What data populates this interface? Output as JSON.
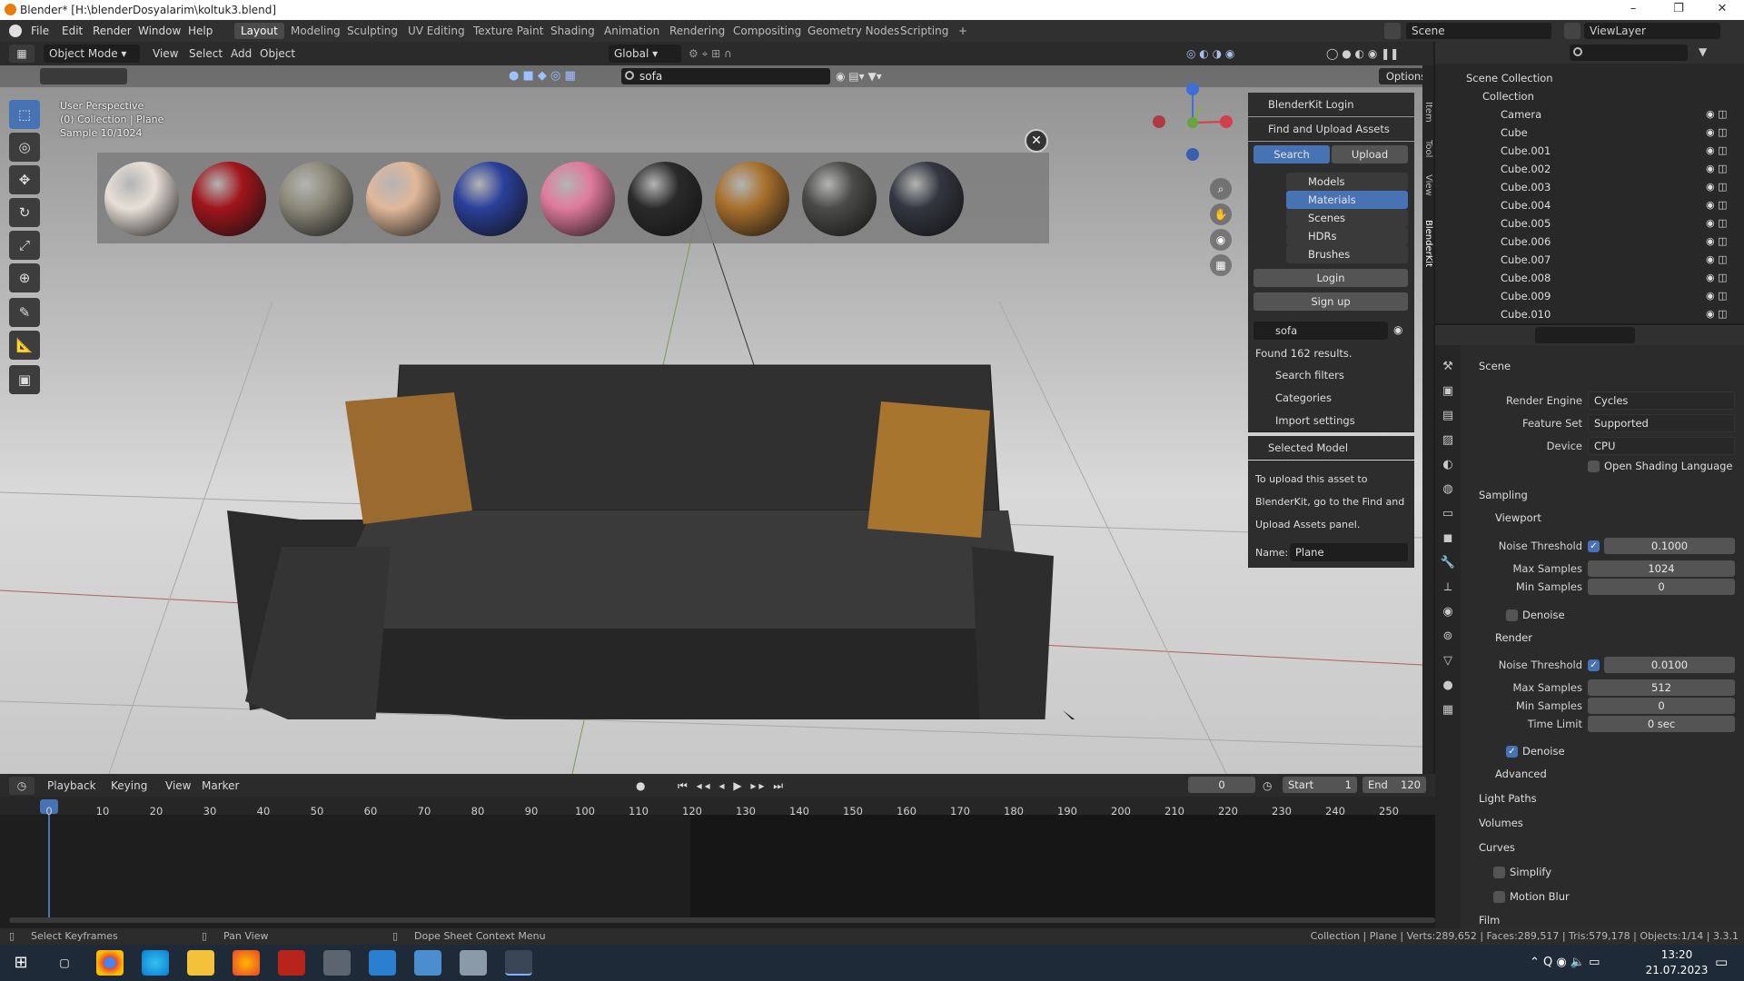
{
  "window": {
    "title": "Blender* [H:\\blenderDosyalarim\\koltuk3.blend]",
    "min": "–",
    "max": "❐",
    "close": "✕"
  },
  "menu": [
    "File",
    "Edit",
    "Render",
    "Window",
    "Help"
  ],
  "workspaces": [
    "Layout",
    "Modeling",
    "Sculpting",
    "UV Editing",
    "Texture Paint",
    "Shading",
    "Animation",
    "Rendering",
    "Compositing",
    "Geometry Nodes",
    "Scripting",
    "+"
  ],
  "scene": {
    "scene_name": "Scene",
    "view_layer": "ViewLayer"
  },
  "header": {
    "mode": "Object Mode",
    "view": "View",
    "select": "Select",
    "add": "Add",
    "object": "Object",
    "orientation": "Global",
    "search": "sofa",
    "options": "Options"
  },
  "overlay": {
    "perspective": "User Perspective",
    "collection": "(0) Collection | Plane",
    "sample": "Sample 10/1024"
  },
  "blenderkit": {
    "login_panel": "BlenderKit Login",
    "find_upload": "Find and Upload Assets",
    "search_btn": "Search",
    "upload_btn": "Upload",
    "categories": [
      "Models",
      "Materials",
      "Scenes",
      "HDRs",
      "Brushes"
    ],
    "selected_category": "Materials",
    "login": "Login",
    "signup": "Sign up",
    "query": "sofa",
    "found": "Found 162 results.",
    "search_filters": "Search filters",
    "categories_label": "Categories",
    "import_settings": "Import settings",
    "selected_model": "Selected Model",
    "upload_hint": [
      "To upload this asset to",
      "BlenderKit, go to the Find and",
      "Upload Assets panel."
    ],
    "name_label": "Name:",
    "name_value": "Plane"
  },
  "side_tabs": [
    "Item",
    "Tool",
    "View",
    "BlenderKit"
  ],
  "gallery": {
    "colors": [
      "#e8e0d8",
      "#a0151b",
      "#8c8a7a",
      "#e0b89a",
      "#2a3f9a",
      "#e07a9c",
      "#2a2a2a",
      "#a8702c",
      "#4a4a48",
      "#333640"
    ]
  },
  "outliner": {
    "root": "Scene Collection",
    "collection": "Collection",
    "items": [
      "Camera",
      "Cube",
      "Cube.001",
      "Cube.002",
      "Cube.003",
      "Cube.004",
      "Cube.005",
      "Cube.006",
      "Cube.007",
      "Cube.008",
      "Cube.009",
      "Cube.010"
    ]
  },
  "props": {
    "context": "Scene",
    "render_engine_label": "Render Engine",
    "render_engine": "Cycles",
    "feature_set_label": "Feature Set",
    "feature_set": "Supported",
    "device_label": "Device",
    "device": "CPU",
    "osl": "Open Shading Language",
    "sampling": "Sampling",
    "viewport": "Viewport",
    "noise_threshold_label": "Noise Threshold",
    "vp_noise": "0.1000",
    "max_samples_label": "Max Samples",
    "vp_max": "1024",
    "min_samples_label": "Min Samples",
    "vp_min": "0",
    "denoise": "Denoise",
    "render": "Render",
    "r_noise": "0.0100",
    "r_max": "512",
    "r_min": "0",
    "time_limit_label": "Time Limit",
    "time_limit": "0 sec",
    "denoise2": "Denoise",
    "advanced": "Advanced",
    "light_paths": "Light Paths",
    "volumes": "Volumes",
    "curves": "Curves",
    "simplify": "Simplify",
    "motion_blur": "Motion Blur",
    "film": "Film"
  },
  "timeline": {
    "playback": "Playback",
    "keying": "Keying",
    "view": "View",
    "marker": "Marker",
    "current": "0",
    "start_label": "Start",
    "start": "1",
    "end_label": "End",
    "end": "120",
    "ticks": [
      "0",
      "10",
      "20",
      "30",
      "40",
      "50",
      "60",
      "70",
      "80",
      "90",
      "100",
      "110",
      "120",
      "130",
      "140",
      "150",
      "160",
      "170",
      "180",
      "190",
      "200",
      "210",
      "220",
      "230",
      "240",
      "250"
    ]
  },
  "status": {
    "left1": "Select Keyframes",
    "left2": "Pan View",
    "left3": "Dope Sheet Context Menu",
    "right": "Collection | Plane | Verts:289,652 | Faces:289,517 | Tris:579,178 | Objects:1/14 | 3.3.1"
  },
  "taskbar": {
    "time": "13:20",
    "date": "21.07.2023"
  }
}
